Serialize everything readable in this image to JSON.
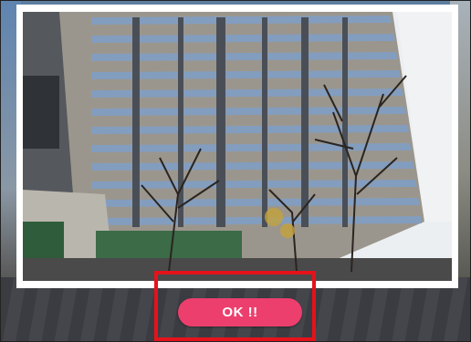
{
  "dialog": {
    "ok_label": "OK !!"
  },
  "colors": {
    "button": "#ec3f6e",
    "highlight": "#e6121a",
    "card": "#ffffff"
  }
}
